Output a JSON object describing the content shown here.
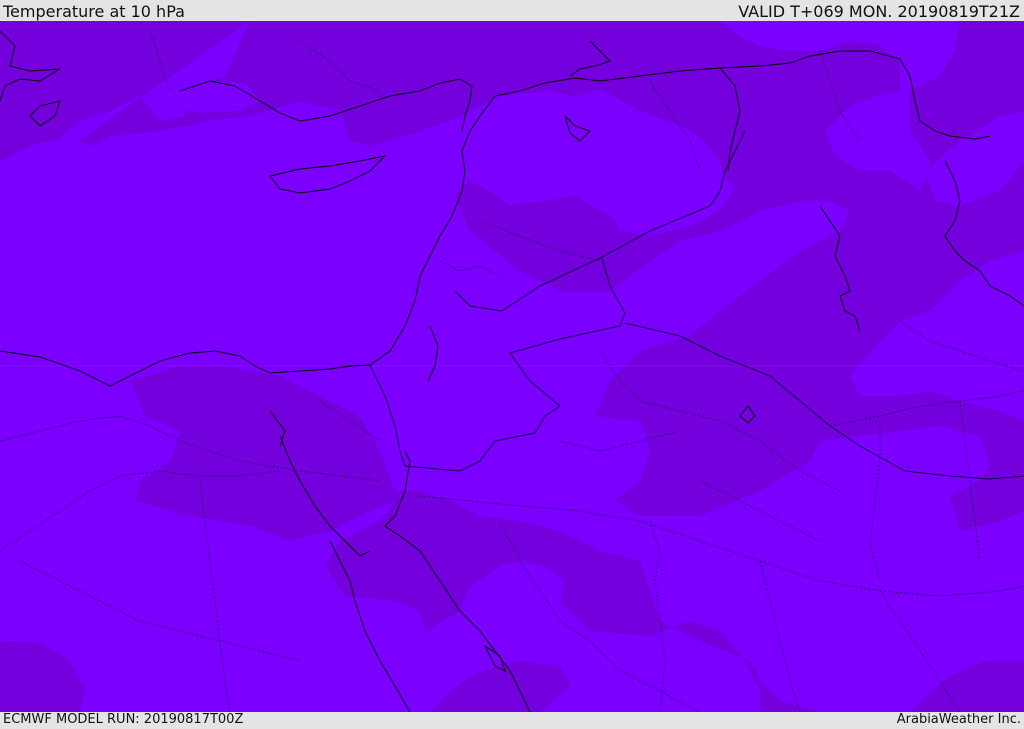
{
  "header": {
    "title": "Temperature at 10 hPa",
    "valid": "VALID T+069 MON. 20190819T21Z"
  },
  "footer": {
    "model_run": "ECMWF MODEL RUN: 20190817T00Z",
    "credit": "ArabiaWeather Inc."
  },
  "map": {
    "colors": {
      "warm_band": "#7b00ff",
      "cool_band": "#7300dd",
      "coast": "#000000",
      "border": "#1a0050"
    }
  }
}
